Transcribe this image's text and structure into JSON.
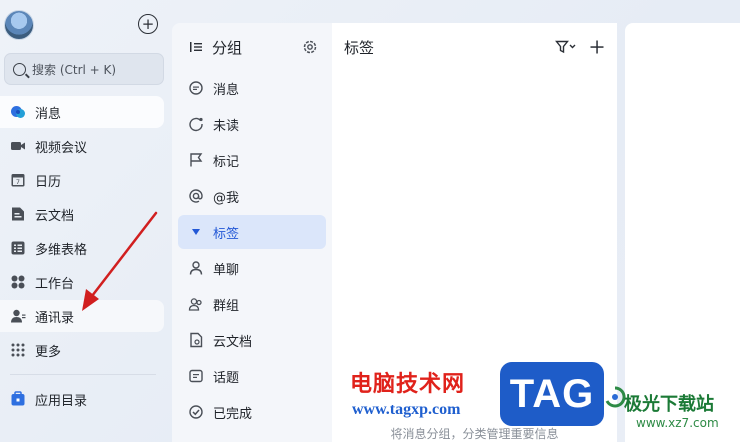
{
  "rail": {
    "search_placeholder": "搜索 (Ctrl + K)",
    "items": [
      {
        "label": "消息",
        "icon": "chat-bubble-icon"
      },
      {
        "label": "视频会议",
        "icon": "video-camera-icon"
      },
      {
        "label": "日历",
        "icon": "calendar-icon"
      },
      {
        "label": "云文档",
        "icon": "cloud-doc-icon"
      },
      {
        "label": "多维表格",
        "icon": "table-icon"
      },
      {
        "label": "工作台",
        "icon": "workplace-grid-icon"
      },
      {
        "label": "通讯录",
        "icon": "contacts-icon"
      },
      {
        "label": "更多",
        "icon": "more-dots-icon"
      }
    ],
    "app_dir": {
      "label": "应用目录",
      "icon": "app-directory-icon"
    }
  },
  "groups": {
    "title": "分组",
    "items": [
      {
        "label": "消息",
        "icon": "message-icon"
      },
      {
        "label": "未读",
        "icon": "unread-icon"
      },
      {
        "label": "标记",
        "icon": "flag-icon"
      },
      {
        "label": "@我",
        "icon": "at-icon"
      },
      {
        "label": "标签",
        "icon": "tag-caret-icon"
      },
      {
        "label": "单聊",
        "icon": "single-chat-icon"
      },
      {
        "label": "群组",
        "icon": "group-icon"
      },
      {
        "label": "云文档",
        "icon": "doc-icon"
      },
      {
        "label": "话题",
        "icon": "topic-icon"
      },
      {
        "label": "已完成",
        "icon": "done-icon"
      }
    ]
  },
  "content": {
    "title": "标签",
    "hint": "将消息分组，分类管理重要信息"
  },
  "watermark": {
    "site_title": "电脑技术网",
    "site_url": "www.tagxp.com",
    "logo_text": "TAG",
    "brand_name": "极光下载站",
    "brand_url": "www.xz7.com"
  },
  "colors": {
    "accent": "#2358d6",
    "active_bg": "#dbe6fa",
    "arrow": "#d11f1f",
    "tag_logo": "#1e5cc8"
  }
}
